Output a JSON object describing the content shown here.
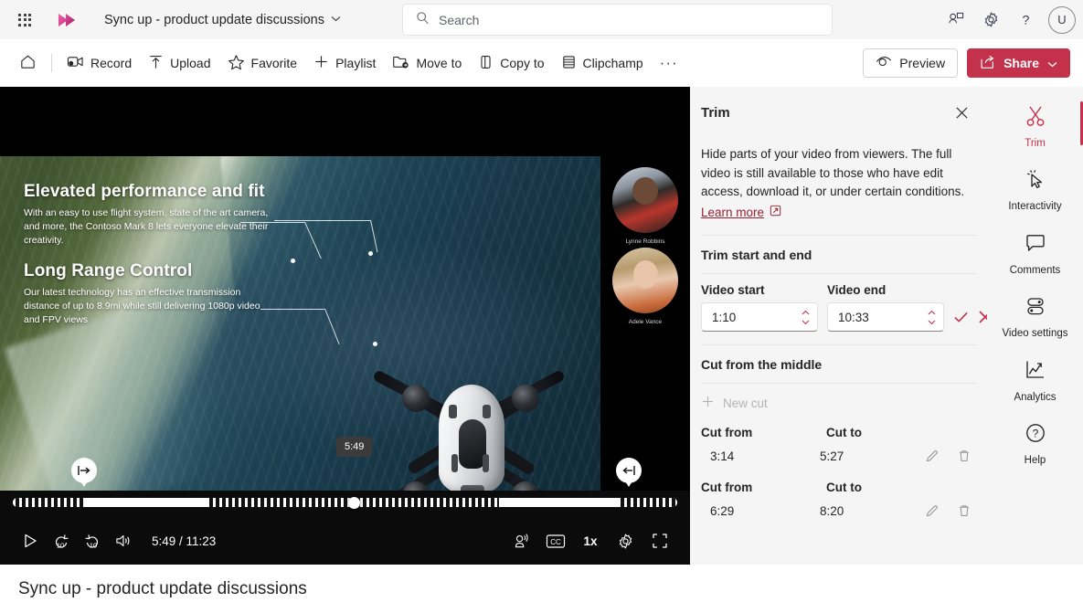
{
  "topbar": {
    "waffle_label": "app-launcher",
    "app_title": "Sync up - product update discussions",
    "chevron": "⌄",
    "search_placeholder": "Search",
    "avatar_initial": "U"
  },
  "commandbar": {
    "items": [
      {
        "label": "Record",
        "icon": "record-icon"
      },
      {
        "label": "Upload",
        "icon": "upload-icon"
      },
      {
        "label": "Favorite",
        "icon": "star-icon"
      },
      {
        "label": "Playlist",
        "icon": "plus-icon"
      },
      {
        "label": "Move to",
        "icon": "move-to-icon"
      },
      {
        "label": "Copy to",
        "icon": "copy-to-icon"
      },
      {
        "label": "Clipchamp",
        "icon": "clipchamp-icon"
      }
    ],
    "overflow": "···",
    "preview_label": "Preview",
    "share_label": "Share",
    "share_chevron": "⌄",
    "share_color": "#c4314b"
  },
  "video": {
    "slide": {
      "heading1": "Elevated performance and fit",
      "body1": "With an easy to use flight system, state of the art camera, and more, the Contoso Mark 8 lets everyone elevate their creativity.",
      "heading2": "Long Range Control",
      "body2": "Our latest technology has an effective transmission distance of up to 8.9mi while still delivering 1080p video and FPV views"
    },
    "participants": [
      {
        "name": "Lynne Robbins"
      },
      {
        "name": "Adele Vance"
      }
    ],
    "controls": {
      "play_label": "play-button",
      "rewind_label": "10",
      "forward_label": "10",
      "volume_label": "volume-button",
      "time_display": "5:49 / 11:23",
      "current_time": "5:49",
      "duration": "11:23",
      "speed": "1x",
      "noise_label": "noise-suppression-button",
      "cc_label": "CC",
      "settings_label": "settings-button",
      "fullscreen_label": "fullscreen-button",
      "scrub_tooltip": "5:49",
      "trim_start_marker": "⇥",
      "trim_end_marker": "⇤",
      "progress_percent": 51
    }
  },
  "trim_panel": {
    "title": "Trim",
    "close_label": "✕",
    "description": "Hide parts of your video from viewers. The full video is still available to those who have edit access, download it, or under certain conditions.",
    "learn_more": "Learn more",
    "section_start_end": "Trim start and end",
    "video_start_label": "Video start",
    "video_start_value": "1:10",
    "video_end_label": "Video end",
    "video_end_value": "10:33",
    "confirm_label": "✓",
    "cancel_label": "✕",
    "section_middle": "Cut from the middle",
    "new_cut_label": "New cut",
    "cut_from_label": "Cut from",
    "cut_to_label": "Cut to",
    "cuts": [
      {
        "from": "3:14",
        "to": "5:27"
      },
      {
        "from": "6:29",
        "to": "8:20"
      }
    ]
  },
  "rail": {
    "items": [
      {
        "label": "Trim",
        "icon": "scissors-icon",
        "active": true
      },
      {
        "label": "Interactivity",
        "icon": "cursor-click-icon",
        "active": false
      },
      {
        "label": "Comments",
        "icon": "comment-icon",
        "active": false
      },
      {
        "label": "Video settings",
        "icon": "toggles-icon",
        "active": false
      },
      {
        "label": "Analytics",
        "icon": "chart-line-icon",
        "active": false
      },
      {
        "label": "Help",
        "icon": "question-circle-icon",
        "active": false
      }
    ]
  },
  "footer": {
    "title": "Sync up - product update discussions"
  }
}
